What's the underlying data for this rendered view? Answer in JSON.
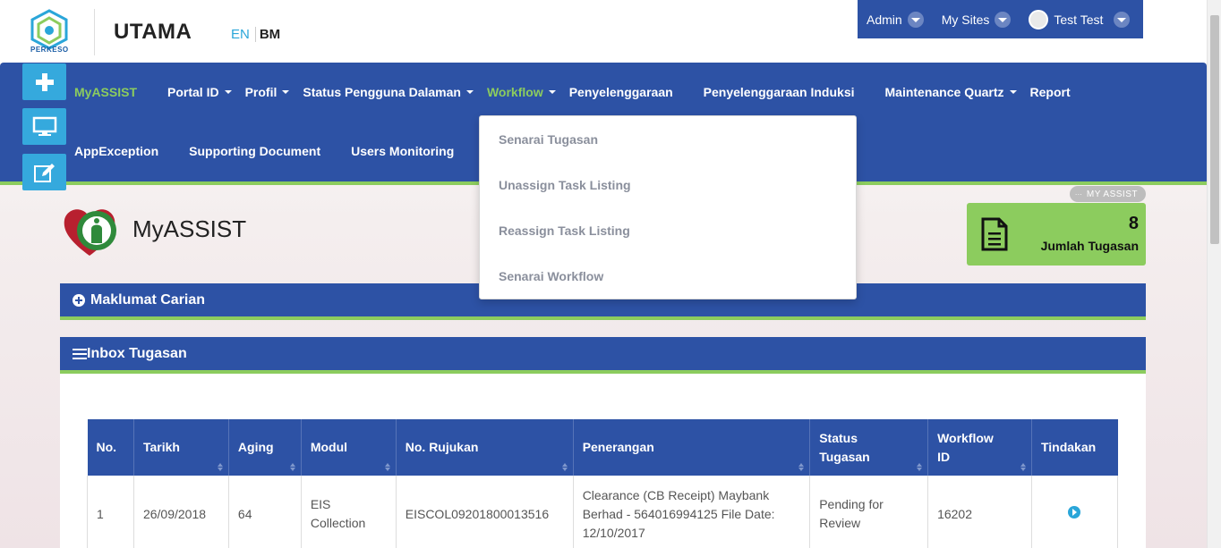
{
  "header": {
    "logo_text": "PERKESO",
    "app_title": "UTAMA",
    "lang_en": "EN",
    "lang_bm": "BM"
  },
  "userbar": {
    "admin": "Admin",
    "my_sites": "My Sites",
    "user": "Test Test"
  },
  "nav": {
    "row1": [
      "MyASSIST",
      "Portal ID",
      "Profil",
      "Status Pengguna Dalaman",
      "Workflow",
      "Penyelenggaraan",
      "Penyelenggaraan Induksi",
      "Maintenance Quartz",
      "Report"
    ],
    "row2": [
      "AppException",
      "Supporting Document",
      "Users Monitoring"
    ]
  },
  "dropdown": {
    "items": [
      "Senarai Tugasan",
      "Unassign Task Listing",
      "Reassign Task Listing",
      "Senarai Workflow"
    ]
  },
  "myassist": {
    "title": "MyASSIST",
    "badge": "MY ASSIST",
    "badge_dots": "...",
    "task_count": "8",
    "task_label": "Jumlah Tugasan"
  },
  "panels": {
    "search": "Maklumat Carian",
    "inbox": "Inbox Tugasan"
  },
  "table": {
    "headers": [
      "No.",
      "Tarikh",
      "Aging",
      "Modul",
      "No. Rujukan",
      "Penerangan",
      "Status Tugasan",
      "Workflow ID",
      "Tindakan"
    ],
    "rows": [
      {
        "no": "1",
        "tarikh": "26/09/2018",
        "aging": "64",
        "modul": "EIS Collection",
        "rujukan": "EISCOL09201800013516",
        "penerangan": "Clearance (CB Receipt) Maybank Berhad - 564016994125 File Date: 12/10/2017",
        "status": "Pending for Review",
        "workflow_id": "16202"
      }
    ]
  },
  "colors": {
    "primary": "#2d52a5",
    "accent_green": "#8ccc5e",
    "side_button": "#35a9dd"
  }
}
